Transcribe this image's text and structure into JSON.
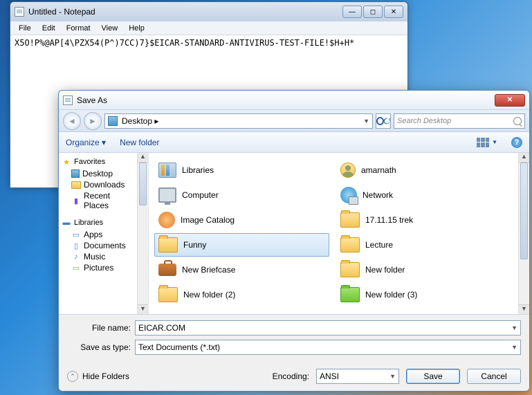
{
  "notepad": {
    "title": "Untitled - Notepad",
    "menu": [
      "File",
      "Edit",
      "Format",
      "View",
      "Help"
    ],
    "content": "X5O!P%@AP[4\\PZX54(P^)7CC)7}$EICAR-STANDARD-ANTIVIRUS-TEST-FILE!$H+H*"
  },
  "saveAs": {
    "title": "Save As",
    "address": "Desktop  ▸",
    "searchPlaceholder": "Search Desktop",
    "toolbar": {
      "organize": "Organize ▾",
      "newfolder": "New folder"
    },
    "tree": {
      "favorites": {
        "label": "Favorites",
        "items": [
          "Desktop",
          "Downloads",
          "Recent Places"
        ]
      },
      "libraries": {
        "label": "Libraries",
        "items": [
          "Apps",
          "Documents",
          "Music",
          "Pictures"
        ]
      }
    },
    "files": {
      "col1": [
        {
          "name": "Libraries",
          "icon": "libs"
        },
        {
          "name": "Computer",
          "icon": "comp"
        },
        {
          "name": "Image Catalog",
          "icon": "img"
        },
        {
          "name": "Funny",
          "icon": "folder",
          "selected": true
        },
        {
          "name": "New Briefcase",
          "icon": "brief"
        },
        {
          "name": "New folder (2)",
          "icon": "folder"
        }
      ],
      "col2": [
        {
          "name": "amarnath",
          "icon": "user"
        },
        {
          "name": "Network",
          "icon": "net"
        },
        {
          "name": "17.11.15 trek",
          "icon": "folder"
        },
        {
          "name": "Lecture",
          "icon": "folder"
        },
        {
          "name": "New folder",
          "icon": "folder"
        },
        {
          "name": "New folder (3)",
          "icon": "folder-green"
        }
      ]
    },
    "fileNameLabel": "File name:",
    "fileName": "EICAR.COM",
    "saveTypeLabel": "Save as type:",
    "saveType": "Text Documents (*.txt)",
    "hideFolders": "Hide Folders",
    "encodingLabel": "Encoding:",
    "encoding": "ANSI",
    "saveBtn": "Save",
    "cancelBtn": "Cancel"
  }
}
